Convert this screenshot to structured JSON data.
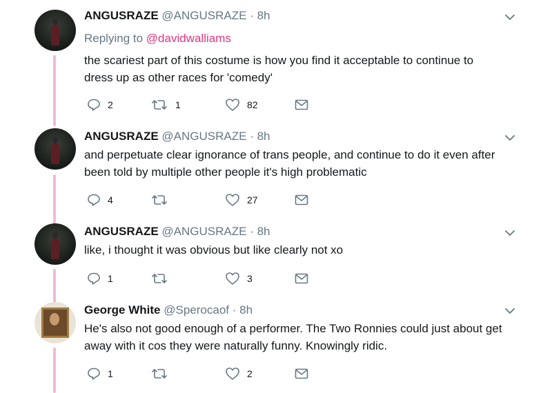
{
  "tweets": [
    {
      "name": "ANGUSRAZE",
      "handle": "@ANGUSRAZE",
      "time": "8h",
      "replying_prefix": "Replying to ",
      "replying_to": "@davidwalliams",
      "text": "the scariest part of this costume is how you find it acceptable to continue to\ndress up as other races for 'comedy'",
      "replies": "2",
      "retweets": "1",
      "likes": "82"
    },
    {
      "name": "ANGUSRAZE",
      "handle": "@ANGUSRAZE",
      "time": "8h",
      "text": "and perpetuate clear ignorance of trans people, and continue to do it even after\nbeen told by multiple other people it's high problematic",
      "replies": "4",
      "retweets": "",
      "likes": "27"
    },
    {
      "name": "ANGUSRAZE",
      "handle": "@ANGUSRAZE",
      "time": "8h",
      "text": "like, i thought it was obvious but like clearly not xo",
      "replies": "1",
      "retweets": "",
      "likes": "3"
    },
    {
      "name": "George White",
      "handle": "@Sperocaof",
      "time": "8h",
      "text": "He's also not good enough of a performer. The Two Ronnies could just about get\naway with it cos they were naturally funny. Knowingly ridic.",
      "replies": "1",
      "retweets": "",
      "likes": "2"
    }
  ],
  "separator": " · ",
  "icons": {
    "reply": "reply-icon",
    "retweet": "retweet-icon",
    "like": "heart-icon",
    "dm": "envelope-icon",
    "menu": "chevron-down-icon"
  },
  "colors": {
    "thread_line": "#f4b8d9",
    "link": "#e0367f",
    "secondary_text": "#657786",
    "icon": "#657786"
  }
}
